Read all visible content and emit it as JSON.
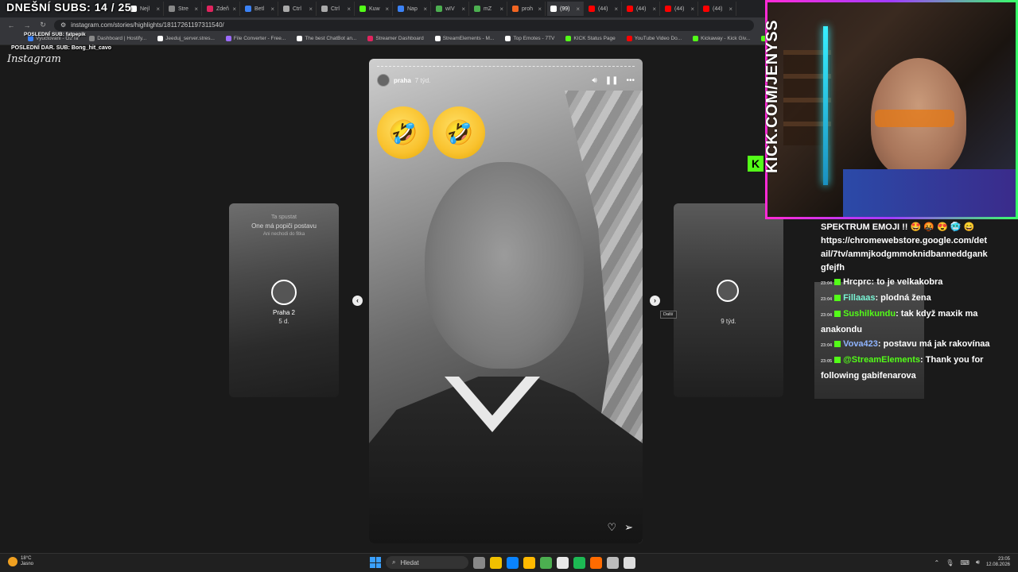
{
  "overlay": {
    "subs_count": "DNEŠNÍ SUBS: 14 / 25",
    "last_sub": "POSLEDNÍ SUB: fatpepik",
    "last_dar": "POSLEDNÍ DAR. SUB: Bong_hit_cavo"
  },
  "browser": {
    "tabs": [
      {
        "label": "Nejl",
        "color": "#ffffff"
      },
      {
        "label": "Stre",
        "color": "#888888"
      },
      {
        "label": "Zdeň",
        "color": "#e0245e"
      },
      {
        "label": "Betl",
        "color": "#3b82f6"
      },
      {
        "label": "Ctrl",
        "color": "#aaaaaa"
      },
      {
        "label": "Ctrl",
        "color": "#aaaaaa"
      },
      {
        "label": "Kuw",
        "color": "#53fc18"
      },
      {
        "label": "Nap",
        "color": "#3b82f6"
      },
      {
        "label": "wIV",
        "color": "#4caf50"
      },
      {
        "label": "mZ",
        "color": "#4caf50"
      },
      {
        "label": "proh",
        "color": "#f26522"
      },
      {
        "label": "(99)",
        "color": "#ffffff"
      },
      {
        "label": "(44)",
        "color": "#ff0000"
      },
      {
        "label": "(44)",
        "color": "#ff0000"
      },
      {
        "label": "(44)",
        "color": "#ff0000"
      },
      {
        "label": "(44)",
        "color": "#ff0000"
      }
    ],
    "url": "instagram.com/stories/highlights/18117261197311540/",
    "bookmarks": [
      {
        "label": "Vyuctovani - O2 fa",
        "color": "#3b82f6"
      },
      {
        "label": "Dashboard | Hostify...",
        "color": "#888888"
      },
      {
        "label": "Jeeduj_server.stres...",
        "color": "#ffffff"
      },
      {
        "label": "File Converter - Free...",
        "color": "#9c6bff"
      },
      {
        "label": "The best ChatBot an...",
        "color": "#ffffff"
      },
      {
        "label": "Streamer Dashboard",
        "color": "#e0245e"
      },
      {
        "label": "StreamElements - M...",
        "color": "#ffffff"
      },
      {
        "label": "Top Emotes - 7TV",
        "color": "#ffffff"
      },
      {
        "label": "KICK Status Page",
        "color": "#53fc18"
      },
      {
        "label": "YouTube Video Do...",
        "color": "#ff0000"
      },
      {
        "label": "Kickaway - Kick Giv...",
        "color": "#53fc18"
      },
      {
        "label": "Kick / Twitch VOD d...",
        "color": "#53fc18"
      }
    ]
  },
  "instagram": {
    "logo": "Instagram",
    "left_story": {
      "line1": "Ta spustat",
      "line2": "One má popiči postavu",
      "line3": "Ani nechodi do fitka",
      "name": "Praha 2",
      "time": "5 d."
    },
    "right_story": {
      "time": "9 týd."
    },
    "story": {
      "username": "praha",
      "time": "7 týd.",
      "emoji": "🤣"
    },
    "tooltip": "Další"
  },
  "stream": {
    "kick_url": "KICK.COM/JENYSS",
    "kick_logo": "K"
  },
  "chat": {
    "promo_line1": "SPEKTRUM EMOJI !! 🤩 🤬 😍 🥶 😄",
    "promo_line2": "https://chromewebstore.google.com/detail/7tv/ammjkodgmmoknidbanneddgankgfejfh",
    "messages": [
      {
        "time": "23:04",
        "user": "Hrcprc",
        "text": ": to je velkakobra",
        "user_color": "#ffffff"
      },
      {
        "time": "23:04",
        "user": "Fillaaas",
        "text": ": plodná žena",
        "user_color": "#7af5d5"
      },
      {
        "time": "23:04",
        "user": "Sushilkundu",
        "text": ": tak když maxik ma anakondu",
        "user_color": "#53fc18"
      },
      {
        "time": "23:04",
        "user": "Vova423",
        "text": ": postavu má jak rakovínaa",
        "user_color": "#8fb4ff"
      },
      {
        "time": "23:05",
        "user": "@StreamElements",
        "text": ": Thank you for following gabifenarova",
        "user_color": "#53fc18"
      }
    ]
  },
  "taskbar": {
    "temp": "18°C",
    "weather": "Jasno",
    "search": "Hledat",
    "time": "23:05",
    "date": "12.08.2026",
    "icons": [
      "#888888",
      "#f0c000",
      "#0a84ff",
      "#ffb900",
      "#4caf50",
      "#e8e8e8",
      "#1db954",
      "#ff6b00",
      "#bbbbbb",
      "#dddddd"
    ]
  }
}
